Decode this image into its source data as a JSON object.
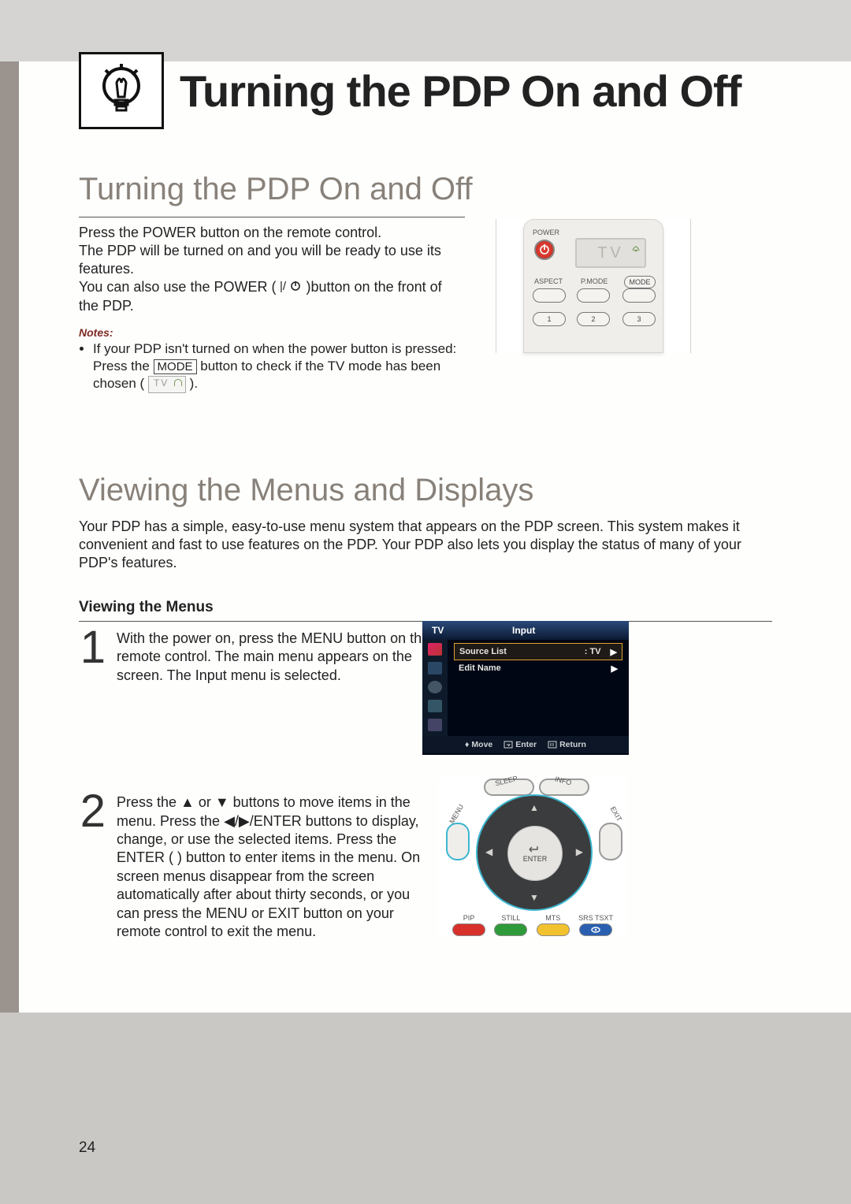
{
  "pageTitle": "Turning the PDP On and Off",
  "pageNumber": "24",
  "sec1": {
    "heading": "Turning the PDP On and Off",
    "p1": "Press the POWER button on the remote control.",
    "p2": "The PDP will be turned on and you will be ready to use its features.",
    "p3a": "You can also use the POWER (",
    "p3b": ")button on the front of the PDP.",
    "notesLabel": "Notes:",
    "note1a": "If your PDP isn't turned on when the power button is pressed: Press the ",
    "note1key": "MODE",
    "note1b": " button to check if the TV mode has been chosen (",
    "note1c": ")."
  },
  "remote": {
    "power": "POWER",
    "aspect": "ASPECT",
    "pmode": "P.MODE",
    "mode": "MODE",
    "lcd": "TV",
    "n1": "1",
    "n2": "2",
    "n3": "3"
  },
  "sec2": {
    "heading": "Viewing the Menus and Displays",
    "intro": "Your PDP has a simple, easy-to-use menu system that appears on the PDP screen. This system makes it convenient and fast to use features on the PDP. Your PDP also lets you display the status of many of your PDP's features.",
    "subhead": "Viewing the Menus",
    "step1": "With the power on, press the MENU button on the remote control. The main menu appears on the screen. The Input menu is selected.",
    "step2": "Press the ▲ or ▼ buttons to move items in the menu. Press the ◀/▶/ENTER buttons to display, change, or use the selected items. Press the ENTER (      ) button to enter items in the menu. On screen menus disappear from the screen automatically after about thirty seconds, or you can press the MENU or EXIT button on your remote control to exit the menu."
  },
  "osd": {
    "tv": "TV",
    "title": "Input",
    "row1": "Source List",
    "row1val": ":  TV",
    "row2": "Edit Name",
    "move": "Move",
    "enter": "Enter",
    "return": "Return"
  },
  "dpad": {
    "sleep": "SLEEP",
    "info": "INFO",
    "menu": "MENU",
    "exit": "EXIT",
    "enter": "ENTER",
    "pip": "PIP",
    "still": "STILL",
    "mts": "MTS",
    "srs": "SRS TSXT"
  }
}
